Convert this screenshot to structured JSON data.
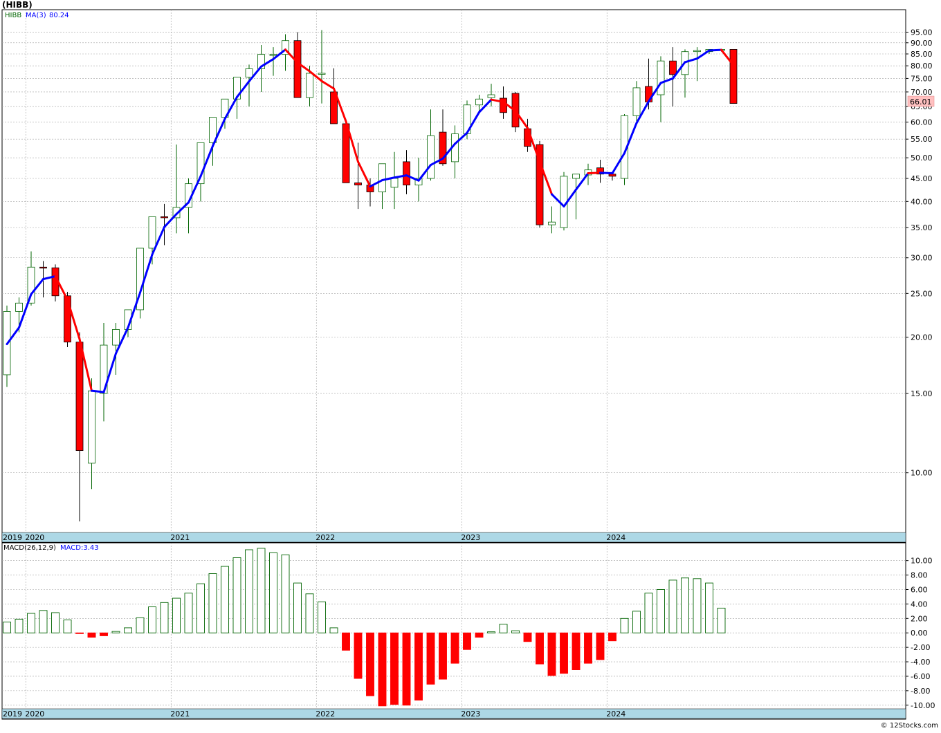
{
  "page": {
    "ticker_title": "(HIBB)",
    "copyright": "© 12Stocks.com"
  },
  "chart_data": [
    {
      "type": "candlestick",
      "panel": "price",
      "symbol": "HIBB",
      "legend": {
        "symbol": "HIBB",
        "ma_label": "MA(3)",
        "ma_value": "80.24"
      },
      "yscale": "log",
      "ylim": [
        7.8,
        100
      ],
      "y_ticks": [
        "10.00",
        "15.00",
        "20.00",
        "25.00",
        "30.00",
        "35.00",
        "40.00",
        "45.00",
        "50.00",
        "55.00",
        "60.00",
        "65.00",
        "70.00",
        "75.00",
        "80.00",
        "85.00",
        "90.00",
        "95.00"
      ],
      "last_price_label": "66.01",
      "x_labels": [
        "2019",
        "2020",
        "2021",
        "2022",
        "2023",
        "2024"
      ],
      "grid": true,
      "colors": {
        "up": "#006400",
        "down": "#ff0000",
        "ma_up": "#0000ff",
        "ma_down": "#ff0000",
        "axis_band": "#add8e6",
        "price_label_bg": "#ffc0c0"
      },
      "months": [
        "2019-11",
        "2019-12",
        "2020-01",
        "2020-02",
        "2020-03",
        "2020-04",
        "2020-05",
        "2020-06",
        "2020-07",
        "2020-08",
        "2020-09",
        "2020-10",
        "2020-11",
        "2020-12",
        "2021-01",
        "2021-02",
        "2021-03",
        "2021-04",
        "2021-05",
        "2021-06",
        "2021-07",
        "2021-08",
        "2021-09",
        "2021-10",
        "2021-11",
        "2021-12",
        "2022-01",
        "2022-02",
        "2022-03",
        "2022-04",
        "2022-05",
        "2022-06",
        "2022-07",
        "2022-08",
        "2022-09",
        "2022-10",
        "2022-11",
        "2022-12",
        "2023-01",
        "2023-02",
        "2023-03",
        "2023-04",
        "2023-05",
        "2023-06",
        "2023-07",
        "2023-08",
        "2023-09",
        "2023-10",
        "2023-11",
        "2023-12",
        "2024-01",
        "2024-02",
        "2024-03",
        "2024-04",
        "2024-05",
        "2024-06",
        "2024-07",
        "2024-08",
        "2024-09",
        "2024-10",
        "2024-11"
      ],
      "open": [
        16.5,
        22.8,
        23.8,
        28.6,
        28.5,
        24.7,
        19.5,
        10.5,
        15.0,
        19.2,
        20.8,
        23.0,
        31.5,
        37.0,
        36.8,
        38.8,
        43.8,
        54.0,
        61.5,
        67.5,
        75.5,
        78.8,
        84.8,
        84.8,
        91.0,
        68.0,
        77.0,
        70.0,
        59.5,
        44.0,
        43.5,
        42.0,
        43.0,
        49.0,
        43.5,
        45.0,
        57.0,
        49.0,
        56.5,
        65.5,
        68.0,
        67.8,
        69.5,
        58.0,
        53.5,
        35.5,
        35.0,
        45.0,
        45.8,
        47.5,
        46.0,
        45.0,
        62.0,
        72.0,
        69.0,
        82.0,
        76.5,
        86.0,
        86.0,
        87.0,
        87.0
      ],
      "high": [
        23.5,
        24.5,
        31.0,
        29.5,
        29.0,
        25.2,
        20.5,
        16.2,
        21.5,
        21.5,
        23.0,
        30.5,
        32.5,
        39.5,
        53.5,
        45.0,
        50.0,
        57.0,
        65.0,
        71.0,
        80.5,
        89.0,
        88.0,
        94.0,
        95.0,
        80.0,
        96.0,
        79.0,
        61.0,
        54.0,
        45.0,
        48.0,
        51.5,
        52.0,
        50.0,
        64.0,
        64.0,
        59.0,
        67.0,
        69.0,
        73.0,
        72.0,
        70.0,
        61.0,
        54.5,
        39.0,
        46.5,
        45.5,
        48.5,
        49.5,
        46.0,
        62.5,
        74.0,
        83.0,
        84.0,
        88.0,
        87.0,
        88.0,
        87.0,
        87.0,
        87.0
      ],
      "low": [
        15.5,
        20.5,
        23.5,
        24.5,
        24.0,
        19.0,
        7.8,
        9.2,
        13.0,
        16.5,
        20.0,
        22.0,
        29.0,
        32.0,
        34.0,
        34.0,
        40.0,
        48.0,
        58.0,
        61.0,
        65.0,
        70.0,
        76.0,
        78.0,
        85.0,
        65.0,
        66.0,
        60.0,
        48.0,
        38.5,
        39.0,
        38.5,
        38.5,
        41.5,
        40.0,
        44.5,
        48.0,
        45.0,
        55.0,
        63.0,
        65.0,
        61.0,
        57.0,
        51.5,
        35.0,
        34.0,
        34.5,
        36.5,
        43.5,
        44.0,
        44.5,
        43.5,
        60.0,
        64.0,
        60.0,
        65.0,
        68.0,
        74.0,
        85.0,
        86.0,
        86.0
      ],
      "close": [
        22.8,
        23.8,
        28.6,
        28.5,
        24.7,
        19.5,
        11.2,
        15.2,
        19.2,
        20.8,
        23.0,
        31.5,
        37.0,
        36.8,
        38.8,
        43.8,
        54.0,
        61.5,
        67.5,
        75.5,
        78.8,
        84.8,
        84.8,
        91.0,
        68.0,
        77.0,
        77.0,
        59.5,
        44.0,
        43.5,
        42.0,
        48.5,
        45.0,
        43.5,
        45.0,
        56.0,
        48.5,
        56.5,
        65.5,
        67.5,
        69.0,
        63.0,
        58.5,
        53.0,
        35.5,
        36.0,
        45.5,
        46.0,
        47.0,
        46.0,
        45.5,
        62.0,
        71.5,
        66.5,
        82.0,
        76.5,
        86.0,
        86.5,
        87.0,
        87.0,
        66.0
      ],
      "ma3": [
        19.3,
        21.0,
        24.9,
        26.9,
        27.3,
        24.2,
        19.8,
        15.2,
        15.1,
        18.4,
        21.0,
        25.1,
        30.5,
        35.1,
        37.5,
        39.8,
        45.5,
        53.1,
        61.0,
        68.2,
        73.9,
        79.7,
        82.8,
        86.9,
        81.3,
        77.8,
        74.0,
        71.2,
        60.2,
        49.0,
        43.2,
        44.6,
        45.2,
        45.7,
        44.5,
        48.2,
        49.8,
        53.7,
        56.8,
        63.1,
        67.3,
        66.5,
        63.5,
        58.2,
        49.0,
        41.5,
        39.0,
        42.5,
        46.2,
        46.3,
        46.2,
        51.2,
        59.7,
        66.7,
        73.3,
        75.0,
        81.5,
        83.0,
        86.5,
        86.8,
        80.2
      ],
      "ma_color_flags": [
        "up",
        "up",
        "up",
        "up",
        "up",
        "down",
        "down",
        "down",
        "up",
        "up",
        "up",
        "up",
        "up",
        "up",
        "up",
        "up",
        "up",
        "up",
        "up",
        "up",
        "up",
        "up",
        "up",
        "up",
        "down",
        "down",
        "down",
        "down",
        "down",
        "down",
        "down",
        "up",
        "up",
        "up",
        "up",
        "up",
        "up",
        "up",
        "up",
        "up",
        "up",
        "down",
        "down",
        "down",
        "down",
        "down",
        "up",
        "up",
        "up",
        "down",
        "up",
        "up",
        "up",
        "up",
        "up",
        "up",
        "up",
        "up",
        "up",
        "up",
        "down"
      ]
    },
    {
      "type": "bar",
      "panel": "macd",
      "legend": {
        "label": "MACD(26,12,9)",
        "value_label": "MACD:3.43"
      },
      "ylim": [
        -10.5,
        11.5
      ],
      "y_ticks": [
        "10.00",
        "8.00",
        "6.00",
        "4.00",
        "2.00",
        "0.00",
        "-2.00",
        "-4.00",
        "-6.00",
        "-8.00",
        "-10.00"
      ],
      "x_labels": [
        "2019",
        "2020",
        "2021",
        "2022",
        "2023",
        "2024"
      ],
      "values": [
        1.5,
        1.9,
        2.7,
        3.1,
        2.8,
        1.8,
        -0.1,
        -0.6,
        -0.4,
        0.2,
        0.7,
        2.1,
        3.6,
        4.2,
        4.8,
        5.5,
        6.8,
        8.2,
        9.2,
        10.4,
        11.5,
        11.7,
        11.1,
        10.8,
        6.9,
        5.4,
        4.3,
        0.7,
        -2.4,
        -6.3,
        -8.7,
        -10.1,
        -9.9,
        -10.0,
        -9.3,
        -7.1,
        -6.4,
        -4.2,
        -2.3,
        -0.6,
        0.15,
        1.2,
        0.3,
        -1.2,
        -4.3,
        -5.9,
        -5.6,
        -5.1,
        -4.2,
        -3.7,
        -1.1,
        2.0,
        3.0,
        5.5,
        6.0,
        7.3,
        7.6,
        7.5,
        6.9,
        3.43
      ]
    }
  ]
}
